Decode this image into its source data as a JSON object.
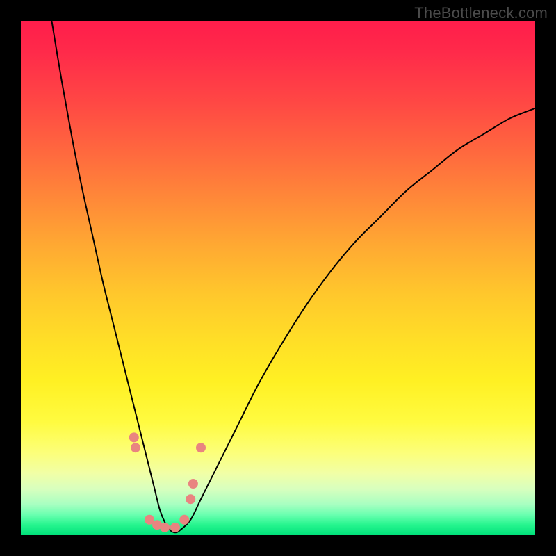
{
  "watermark": "TheBottleneck.com",
  "chart_data": {
    "type": "line",
    "title": "",
    "xlabel": "",
    "ylabel": "",
    "xlim": [
      0,
      100
    ],
    "ylim": [
      0,
      100
    ],
    "grid": false,
    "legend": false,
    "annotations": [],
    "series": [
      {
        "name": "curve",
        "x": [
          6,
          8,
          10,
          12,
          14,
          16,
          18,
          20,
          22,
          23.5,
          25,
          26,
          27,
          28,
          29,
          30,
          31,
          33,
          35,
          38,
          42,
          46,
          50,
          55,
          60,
          65,
          70,
          75,
          80,
          85,
          90,
          95,
          100
        ],
        "y": [
          100,
          88,
          77,
          67,
          58,
          49,
          41,
          33,
          25,
          19,
          13,
          9,
          5,
          2.5,
          1,
          0.5,
          1,
          3,
          7,
          13,
          21,
          29,
          36,
          44,
          51,
          57,
          62,
          67,
          71,
          75,
          78,
          81,
          83
        ],
        "color": "#000000",
        "linewidth": 2
      }
    ],
    "markers": [
      {
        "x": 22.0,
        "y": 19.0,
        "r": 7,
        "color": "#e98480"
      },
      {
        "x": 22.3,
        "y": 17.0,
        "r": 7,
        "color": "#e98480"
      },
      {
        "x": 25.0,
        "y": 3.0,
        "r": 7,
        "color": "#e98480"
      },
      {
        "x": 26.5,
        "y": 2.0,
        "r": 7,
        "color": "#e98480"
      },
      {
        "x": 28.0,
        "y": 1.5,
        "r": 7,
        "color": "#e98480"
      },
      {
        "x": 30.0,
        "y": 1.5,
        "r": 7,
        "color": "#e98480"
      },
      {
        "x": 31.8,
        "y": 3.0,
        "r": 7,
        "color": "#e98480"
      },
      {
        "x": 33.0,
        "y": 7.0,
        "r": 7,
        "color": "#e98480"
      },
      {
        "x": 33.5,
        "y": 10.0,
        "r": 7,
        "color": "#e98480"
      },
      {
        "x": 35.0,
        "y": 17.0,
        "r": 7,
        "color": "#e98480"
      }
    ],
    "background_gradient": {
      "direction": "vertical",
      "stops": [
        {
          "pos": 0.0,
          "color": "#ff1d4b"
        },
        {
          "pos": 0.5,
          "color": "#ffc72c"
        },
        {
          "pos": 0.8,
          "color": "#fffb40"
        },
        {
          "pos": 1.0,
          "color": "#00e07a"
        }
      ]
    }
  }
}
